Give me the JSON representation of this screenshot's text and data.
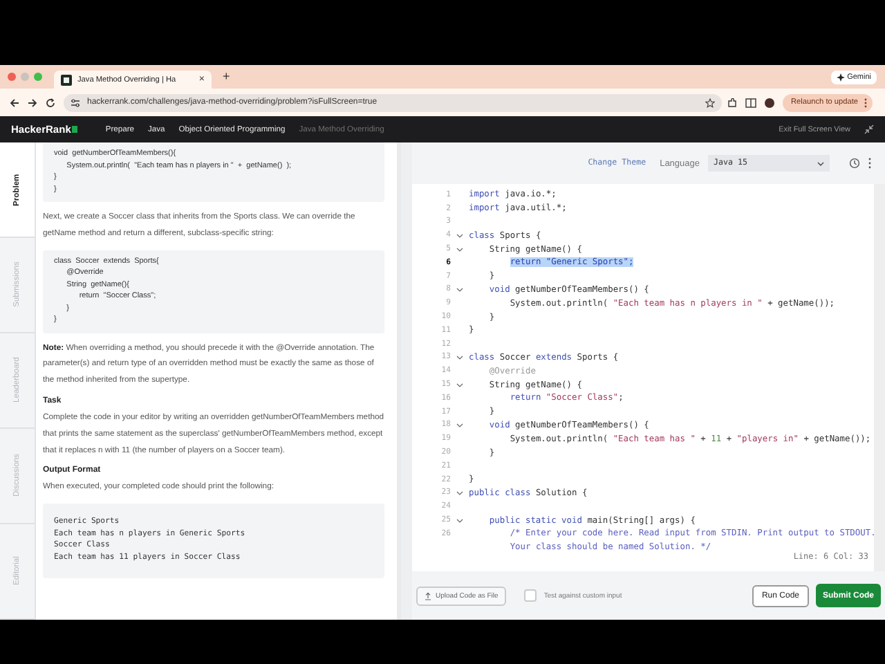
{
  "browser": {
    "tab_title": "Java Method Overriding | Ha",
    "tab_close": "×",
    "new_tab": "+",
    "gemini": "Gemini",
    "url": "hackerrank.com/challenges/java-method-overriding/problem?isFullScreen=true",
    "relaunch": "Relaunch to update"
  },
  "nav": {
    "logo": "HackerRank",
    "breadcrumbs": [
      {
        "label": "Prepare",
        "current": false
      },
      {
        "label": "Java",
        "current": false
      },
      {
        "label": "Object Oriented Programming",
        "current": false
      },
      {
        "label": "Java Method Overriding",
        "current": true
      }
    ],
    "exit": "Exit Full Screen View"
  },
  "side_tabs": [
    {
      "label": "Problem",
      "selected": true
    },
    {
      "label": "Submissions",
      "selected": false
    },
    {
      "label": "Leaderboard",
      "selected": false
    },
    {
      "label": "Discussions",
      "selected": false
    },
    {
      "label": "Editorial",
      "selected": false
    }
  ],
  "problem": {
    "blocks": [
      {
        "kind": "code",
        "lines": [
          "void  getNumberOfTeamMembers(){",
          "      System.out.println(  \"Each team has n players in \"  +  getName()  );",
          "}",
          "}"
        ]
      },
      {
        "kind": "paragraph",
        "text": "Next, we create a Soccer class that inherits from the Sports class. We can override the getName method and return a different, subclass-specific string:"
      },
      {
        "kind": "code",
        "lines": [
          "class  Soccer  extends  Sports{",
          "      @Override",
          "      String  getName(){",
          "            return  \"Soccer Class\";",
          "      }",
          "}"
        ]
      },
      {
        "kind": "paragraph",
        "text": "**Note:** When overriding a method, you should precede it with the @Override annotation. The parameter(s) and return type of an overridden method must be exactly the same as those of the method inherited from the supertype."
      },
      {
        "kind": "heading",
        "text": "Task"
      },
      {
        "kind": "paragraph",
        "text": "Complete the code in your editor by writing an overridden getNumberOfTeamMembers method that prints the same statement as the superclass' getNumberOfTeamMembers method, except that it replaces n with 11 (the number of players on a Soccer team)."
      },
      {
        "kind": "heading",
        "text": "Output Format"
      },
      {
        "kind": "paragraph",
        "text": "When executed, your completed code should print the following:"
      },
      {
        "kind": "output",
        "lines": [
          "Generic Sports",
          "Each team has n players in Generic Sports",
          "Soccer Class",
          "Each team has 11 players in Soccer Class"
        ]
      }
    ]
  },
  "editor": {
    "change_theme": "Change Theme",
    "language_label": "Language",
    "language": "Java 15",
    "lines": [
      {
        "num": "1",
        "fold": false,
        "current": false,
        "segments": [
          {
            "kind": "keyword",
            "text": "import"
          },
          {
            "kind": "plain",
            "text": " java.io.*;"
          }
        ]
      },
      {
        "num": "2",
        "fold": false,
        "current": false,
        "segments": [
          {
            "kind": "keyword",
            "text": "import"
          },
          {
            "kind": "plain",
            "text": " java.util.*;"
          }
        ]
      },
      {
        "num": "3",
        "fold": false,
        "current": false
      },
      {
        "num": "4",
        "fold": true,
        "current": false,
        "segments": [
          {
            "kind": "keyword",
            "text": "class"
          },
          {
            "kind": "plain",
            "text": " Sports {"
          }
        ]
      },
      {
        "num": "5",
        "fold": true,
        "current": false,
        "segments": [
          {
            "kind": "plain",
            "text": "    String getName() {"
          }
        ]
      },
      {
        "num": "6",
        "fold": false,
        "current": true,
        "segments": [
          {
            "kind": "selected",
            "text": "        return \"Generic Sports\";"
          }
        ]
      },
      {
        "num": "7",
        "fold": false,
        "current": false,
        "segments": [
          {
            "kind": "plain",
            "text": "    }"
          }
        ]
      },
      {
        "num": "8",
        "fold": true,
        "current": false,
        "segments": [
          {
            "kind": "keyword",
            "text": "    void"
          },
          {
            "kind": "plain",
            "text": " getNumberOfTeamMembers() {"
          }
        ]
      },
      {
        "num": "9",
        "fold": false,
        "current": false,
        "segments": [
          {
            "kind": "plain",
            "text": "        System.out.println( "
          },
          {
            "kind": "string",
            "text": "\"Each team has n players in \""
          },
          {
            "kind": "plain",
            "text": " + getName());"
          }
        ]
      },
      {
        "num": "10",
        "fold": false,
        "current": false,
        "segments": [
          {
            "kind": "plain",
            "text": "    }"
          }
        ]
      },
      {
        "num": "11",
        "fold": false,
        "current": false,
        "segments": [
          {
            "kind": "plain",
            "text": "}"
          }
        ]
      },
      {
        "num": "12",
        "fold": false,
        "current": false
      },
      {
        "num": "13",
        "fold": true,
        "current": false,
        "segments": [
          {
            "kind": "keyword",
            "text": "class"
          },
          {
            "kind": "plain",
            "text": " Soccer "
          },
          {
            "kind": "keyword",
            "text": "extends"
          },
          {
            "kind": "plain",
            "text": " Sports {"
          }
        ]
      },
      {
        "num": "14",
        "fold": false,
        "current": false,
        "segments": [
          {
            "kind": "annotation",
            "text": "    @Override"
          }
        ]
      },
      {
        "num": "15",
        "fold": true,
        "current": false,
        "segments": [
          {
            "kind": "plain",
            "text": "    String getName() {"
          }
        ]
      },
      {
        "num": "16",
        "fold": false,
        "current": false,
        "segments": [
          {
            "kind": "keyword",
            "text": "        return"
          },
          {
            "kind": "string",
            "text": " \"Soccer Class\""
          },
          {
            "kind": "plain",
            "text": ";"
          }
        ]
      },
      {
        "num": "17",
        "fold": false,
        "current": false,
        "segments": [
          {
            "kind": "plain",
            "text": "    }"
          }
        ]
      },
      {
        "num": "18",
        "fold": true,
        "current": false,
        "segments": [
          {
            "kind": "keyword",
            "text": "    void"
          },
          {
            "kind": "plain",
            "text": " getNumberOfTeamMembers() {"
          }
        ]
      },
      {
        "num": "19",
        "fold": false,
        "current": false,
        "segments": [
          {
            "kind": "plain",
            "text": "        System.out.println( "
          },
          {
            "kind": "string",
            "text": "\"Each team has \""
          },
          {
            "kind": "plain",
            "text": " + "
          },
          {
            "kind": "number",
            "text": "11"
          },
          {
            "kind": "plain",
            "text": " + "
          },
          {
            "kind": "string",
            "text": "\"players in\""
          },
          {
            "kind": "plain",
            "text": " + getName());"
          }
        ]
      },
      {
        "num": "20",
        "fold": false,
        "current": false,
        "segments": [
          {
            "kind": "plain",
            "text": "    }"
          }
        ]
      },
      {
        "num": "21",
        "fold": false,
        "current": false
      },
      {
        "num": "22",
        "fold": false,
        "current": false,
        "segments": [
          {
            "kind": "plain",
            "text": "}"
          }
        ]
      },
      {
        "num": "23",
        "fold": true,
        "current": false,
        "segments": [
          {
            "kind": "keyword",
            "text": "public class"
          },
          {
            "kind": "plain",
            "text": " Solution {"
          }
        ]
      },
      {
        "num": "24",
        "fold": false,
        "current": false
      },
      {
        "num": "25",
        "fold": true,
        "current": false,
        "segments": [
          {
            "kind": "keyword",
            "text": "    public static void"
          },
          {
            "kind": "plain",
            "text": " main(String[] args) {"
          }
        ]
      },
      {
        "num": "26",
        "fold": false,
        "current": false,
        "segments": [
          {
            "kind": "comment",
            "text": "        /* Enter your code here. Read input from STDIN. Print output to STDOUT."
          }
        ]
      },
      {
        "fold": false,
        "segments": [
          {
            "kind": "comment",
            "text": "        Your class should be named Solution. */"
          }
        ]
      }
    ],
    "status": "Line: 6 Col: 33"
  },
  "footer": {
    "upload": "Upload Code as File",
    "custom_input": {
      "label": "Test against custom input",
      "checked": false
    },
    "run": "Run Code",
    "submit": "Submit Code"
  }
}
